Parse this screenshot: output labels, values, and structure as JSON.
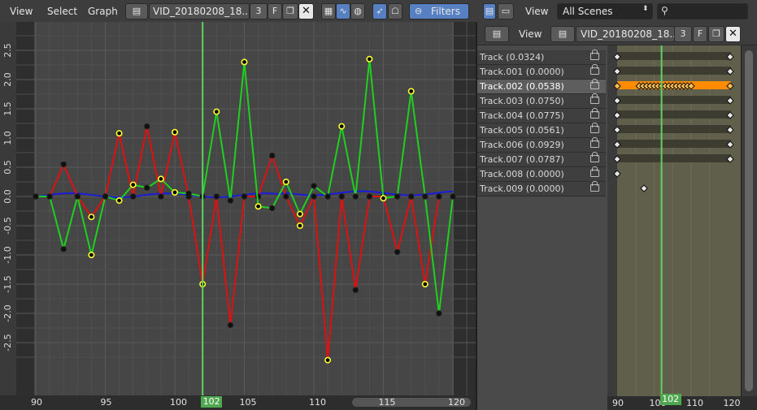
{
  "graph_header": {
    "menus": [
      "View",
      "Select",
      "Graph"
    ],
    "action_name": "VID_20180208_18..",
    "users": "3",
    "fake_user": "F",
    "filters_label": "Filters"
  },
  "dope_header": {
    "scenes_menu": "View",
    "scene_selector": "All Scenes",
    "menu": "View",
    "action_name": "VID_20180208_18..",
    "users": "3",
    "fake_user": "F"
  },
  "graph": {
    "current_frame": "102",
    "x_ticks": [
      "90",
      "95",
      "100",
      "105",
      "110",
      "115",
      "120"
    ],
    "y_ticks": [
      "2.5",
      "2.0",
      "1.5",
      "1.0",
      "0.5",
      "0.0",
      "-0.5",
      "-1.0",
      "-1.5",
      "-2.0",
      "-2.5"
    ],
    "colors": {
      "x_curve": "#e01010",
      "y_curve": "#1ed01e",
      "z_curve": "#1c1cd8",
      "selected_key": "#ffff33",
      "playhead": "#5fd35f"
    },
    "curves": {
      "red": [
        [
          90,
          0
        ],
        [
          91,
          0
        ],
        [
          92,
          0.55
        ],
        [
          93,
          0
        ],
        [
          94,
          -0.35
        ],
        [
          95,
          0
        ],
        [
          96,
          1.08
        ],
        [
          97,
          0
        ],
        [
          98,
          1.2
        ],
        [
          99,
          0
        ],
        [
          100,
          1.1
        ],
        [
          101,
          0
        ],
        [
          102,
          -1.5
        ],
        [
          103,
          0
        ],
        [
          104,
          -2.2
        ],
        [
          105,
          0
        ],
        [
          106,
          0.0
        ],
        [
          107,
          0.7
        ],
        [
          108,
          0
        ],
        [
          109,
          -0.5
        ],
        [
          110,
          0
        ],
        [
          111,
          -2.8
        ],
        [
          112,
          0
        ],
        [
          113,
          -1.6
        ],
        [
          114,
          0
        ],
        [
          115,
          0
        ],
        [
          116,
          -0.95
        ],
        [
          117,
          0
        ],
        [
          118,
          -1.5
        ],
        [
          119,
          0
        ]
      ],
      "green": [
        [
          90,
          0
        ],
        [
          91,
          0
        ],
        [
          92,
          -0.9
        ],
        [
          93,
          0
        ],
        [
          94,
          -1.0
        ],
        [
          95,
          0
        ],
        [
          96,
          -0.07
        ],
        [
          97,
          0.2
        ],
        [
          98,
          0.15
        ],
        [
          99,
          0.3
        ],
        [
          100,
          0.07
        ],
        [
          101,
          0.05
        ],
        [
          102,
          0
        ],
        [
          103,
          1.45
        ],
        [
          104,
          -0.07
        ],
        [
          105,
          2.3
        ],
        [
          106,
          -0.17
        ],
        [
          107,
          -0.2
        ],
        [
          108,
          0.25
        ],
        [
          109,
          -0.3
        ],
        [
          110,
          0.18
        ],
        [
          111,
          0
        ],
        [
          112,
          1.2
        ],
        [
          113,
          0
        ],
        [
          114,
          2.35
        ],
        [
          115,
          -0.03
        ],
        [
          116,
          0
        ],
        [
          117,
          1.8
        ],
        [
          118,
          0
        ],
        [
          119,
          -2.0
        ],
        [
          120,
          0
        ]
      ]
    }
  },
  "channels": [
    {
      "label": "Track (0.0324)"
    },
    {
      "label": "Track.001 (0.0000)"
    },
    {
      "label": "Track.002 (0.0538)"
    },
    {
      "label": "Track.003 (0.0750)"
    },
    {
      "label": "Track.004 (0.0775)"
    },
    {
      "label": "Track.005 (0.0561)"
    },
    {
      "label": "Track.006 (0.0929)"
    },
    {
      "label": "Track.007 (0.0787)"
    },
    {
      "label": "Track.008 (0.0000)"
    },
    {
      "label": "Track.009 (0.0000)"
    }
  ],
  "dopesheet": {
    "current_frame": "102",
    "x_ticks": [
      "90",
      "100",
      "102",
      "110",
      "120"
    ]
  }
}
